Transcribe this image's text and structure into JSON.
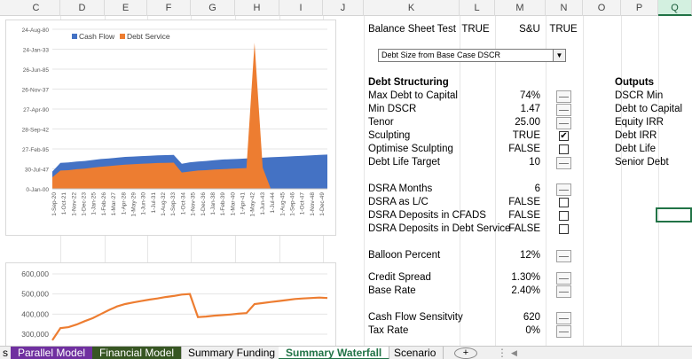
{
  "columns": [
    "C",
    "D",
    "E",
    "F",
    "G",
    "H",
    "I",
    "J",
    "K",
    "L",
    "M",
    "N",
    "O",
    "P",
    "Q"
  ],
  "top_row": {
    "label": "Balance Sheet Test",
    "l": "TRUE",
    "m": "S&U",
    "n": "TRUE"
  },
  "dropdown": {
    "value": "Debt Size from Base Case DSCR"
  },
  "section_title": "Debt Structuring",
  "outputs_title": "Outputs",
  "rows": [
    {
      "label": "Max Debt to Capital",
      "value": "74%",
      "control": "spin"
    },
    {
      "label": "Min DSCR",
      "value": "1.47",
      "control": "spin"
    },
    {
      "label": "Tenor",
      "value": "25.00",
      "control": "spin"
    },
    {
      "label": "Sculpting",
      "value": "TRUE",
      "control": "check",
      "checked": "✔"
    },
    {
      "label": "Optimise Sculpting",
      "value": "FALSE",
      "control": "check",
      "checked": ""
    },
    {
      "label": "Debt Life Target",
      "value": "10",
      "control": "spin"
    },
    {
      "label": "DSRA Months",
      "value": "6",
      "control": "spin"
    },
    {
      "label": "DSRA as L/C",
      "value": "FALSE",
      "control": "check",
      "checked": ""
    },
    {
      "label": "DSRA Deposits in CFADS",
      "value": "FALSE",
      "control": "check",
      "checked": ""
    },
    {
      "label": "DSRA Deposits in Debt Service",
      "value": "FALSE",
      "control": "check",
      "checked": ""
    },
    {
      "label": "Balloon Percent",
      "value": "12%",
      "control": "spin"
    },
    {
      "label": "Credit Spread",
      "value": "1.30%",
      "control": "spin"
    },
    {
      "label": "Base Rate",
      "value": "2.40%",
      "control": "spin"
    },
    {
      "label": "Cash Flow Sensitvity",
      "value": "620",
      "control": "spin"
    },
    {
      "label": "Tax Rate",
      "value": "0%",
      "control": "spin"
    }
  ],
  "outputs": [
    "DSCR Min",
    "Debt to Capital",
    "Equity IRR",
    "Debt IRR",
    "Debt Life",
    "Senior Debt"
  ],
  "colors": {
    "cash_flow": "#4472c4",
    "debt_service": "#ed7d31",
    "excel_green": "#217346"
  },
  "tabs": [
    {
      "label": "s",
      "style": "plain"
    },
    {
      "label": "Parallel Model",
      "style": "purple"
    },
    {
      "label": "Financial Model",
      "style": "green"
    },
    {
      "label": "Summary Funding",
      "style": "plain"
    },
    {
      "label": "Summary Waterfall",
      "style": "active"
    },
    {
      "label": "Scenario",
      "style": "plain"
    },
    {
      "label": "+",
      "style": "add"
    }
  ],
  "chart_data": [
    {
      "type": "area",
      "title": "",
      "xlabel": "",
      "ylabel": "",
      "y_ticks": [
        "0-Jan-00",
        "30-Jul-47",
        "27-Feb-95",
        "28-Sep-42",
        "27-Apr-90",
        "26-Nov-37",
        "26-Jun-85",
        "24-Jan-33",
        "24-Aug-80"
      ],
      "x_ticks": [
        "1-Sep-20",
        "1-Oct-21",
        "1-Nov-22",
        "1-Dec-23",
        "1-Jan-25",
        "1-Feb-26",
        "1-Mar-27",
        "1-Apr-28",
        "1-May-29",
        "1-Jun-30",
        "1-Jul-31",
        "1-Aug-32",
        "1-Sep-33",
        "1-Oct-34",
        "1-Nov-35",
        "1-Dec-36",
        "1-Jan-38",
        "1-Feb-39",
        "1-Mar-40",
        "1-Apr-41",
        "1-May-42",
        "1-Jun-43",
        "1-Jul-44",
        "1-Aug-45",
        "1-Sep-46",
        "1-Oct-47",
        "1-Nov-48",
        "1-Dec-49"
      ],
      "legend": "top-left",
      "series": [
        {
          "name": "Cash Flow",
          "color": "#4472c4",
          "values": [
            0.9,
            1.35,
            1.37,
            1.42,
            1.45,
            1.5,
            1.55,
            1.58,
            1.62,
            1.66,
            1.68,
            1.7,
            1.72,
            1.74,
            1.75,
            1.76,
            1.3,
            1.38,
            1.42,
            1.45,
            1.49,
            1.52,
            1.54,
            1.56,
            1.58,
            1.6,
            1.62,
            1.64,
            1.66,
            1.68,
            1.7,
            1.72,
            1.74,
            1.76,
            1.78
          ]
        },
        {
          "name": "Debt Service",
          "color": "#ed7d31",
          "values": [
            0.6,
            0.95,
            0.97,
            1.02,
            1.05,
            1.1,
            1.15,
            1.18,
            1.22,
            1.26,
            1.28,
            1.3,
            1.32,
            1.34,
            1.35,
            1.36,
            0.85,
            0.9,
            0.95,
            0.97,
            1.0,
            1.02,
            1.04,
            1.06,
            1.08,
            7.6,
            1.1,
            0,
            0,
            0,
            0,
            0,
            0,
            0,
            0
          ]
        }
      ]
    },
    {
      "type": "line",
      "title": "",
      "y_ticks": [
        "300,000",
        "400,000",
        "500,000",
        "600,000"
      ],
      "ylim": [
        250000,
        620000
      ],
      "series": [
        {
          "name": "",
          "color": "#ed7d31",
          "values": [
            270000,
            330000,
            335000,
            348000,
            365000,
            380000,
            400000,
            420000,
            438000,
            450000,
            458000,
            465000,
            472000,
            478000,
            485000,
            490000,
            497000,
            500000,
            385000,
            388000,
            392000,
            395000,
            398000,
            402000,
            405000,
            450000,
            455000,
            460000,
            465000,
            470000,
            475000,
            478000,
            480000,
            482000,
            480000
          ]
        }
      ]
    }
  ]
}
